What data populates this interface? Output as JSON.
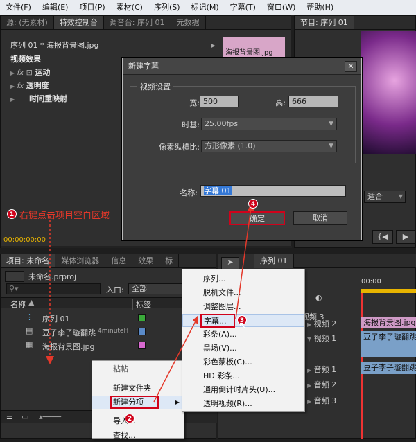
{
  "menu": [
    "文件(F)",
    "编辑(E)",
    "项目(P)",
    "素材(C)",
    "序列(S)",
    "标记(M)",
    "字幕(T)",
    "窗口(W)",
    "帮助(H)"
  ],
  "top_left_tabs": [
    "源: (无素材)",
    "特效控制台",
    "调音台: 序列 01",
    "元数据"
  ],
  "program_tab": "节目: 序列 01",
  "effects": {
    "header": "序列 01 * 海报背景图.jpg",
    "clip_label": "海报背景图.jpg",
    "section": "视频效果",
    "items": [
      "运动",
      "透明度",
      "时间重映射"
    ],
    "timecode": "00:00:00:00"
  },
  "program": {
    "fit": "适合"
  },
  "dialog": {
    "title": "新建字幕",
    "group": "视频设置",
    "width_label": "宽:",
    "width": "500",
    "height_label": "高:",
    "height": "666",
    "timebase_label": "时基:",
    "timebase": "25.00fps",
    "par_label": "像素纵横比:",
    "par": "方形像素 (1.0)",
    "name_label": "名称:",
    "name": "字幕 01",
    "ok": "确定",
    "cancel": "取消"
  },
  "project_tabs": [
    "项目: 未命名",
    "媒体浏览器",
    "信息",
    "效果",
    "标"
  ],
  "project": {
    "file": "未命名.prproj",
    "entry_label": "入口:",
    "entry": "全部",
    "col_name": "名称",
    "col_tag": "标签",
    "items": [
      {
        "name": "序列 01"
      },
      {
        "name": "豆子李子璇翻跳",
        "extra": "4minuteH"
      },
      {
        "name": "海报背景图.jpg"
      }
    ],
    "tag_colors": [
      "#3aaa3a",
      "#5a8ac8",
      "#d869d0"
    ]
  },
  "annotation1": "右键点击项目空白区域",
  "context_menu": {
    "title": "粘帖",
    "items": [
      "新建文件夹",
      "新建分项",
      "导入...",
      "查找..."
    ]
  },
  "submenu": {
    "items": [
      "序列...",
      "脱机文件...",
      "调整图层...",
      "字幕...",
      "彩条(A)...",
      "黑场(V)...",
      "彩色蒙板(C)...",
      "HD 彩条...",
      "通用倒计时片头(U)...",
      "透明视频(R)..."
    ]
  },
  "timeline": {
    "tab": "序列 01",
    "time": "00:00",
    "tracks": [
      "视频 3",
      "视频 2",
      "视频 1",
      "音频 1",
      "音频 2",
      "音频 3"
    ],
    "clip_image": "海报背景图.jpg",
    "clip_video": "豆子李子璇翻跳",
    "clip_audio": "豆子李子璇翻跳"
  },
  "badges": [
    "1",
    "2",
    "3",
    "4"
  ]
}
